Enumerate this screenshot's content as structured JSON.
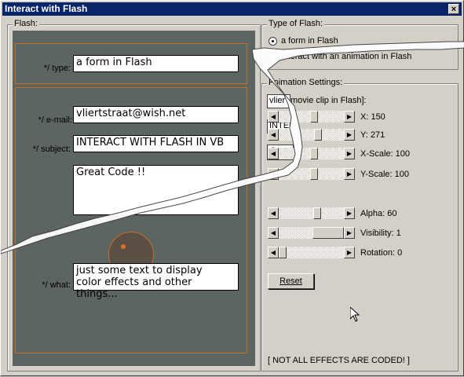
{
  "window": {
    "title": "Interact with Flash",
    "close_glyph": "×"
  },
  "flash_group": {
    "label": "Flash:",
    "type_label": "*/ type:",
    "type_value": "a form in Flash",
    "email_label": "*/ e-mail:",
    "email_value": "vliertstraat@wish.net",
    "subject_label": "*/ subject:",
    "subject_value": "INTERACT WITH FLASH IN VB",
    "code_value": "Great Code !!",
    "what_label": "*/ what:",
    "what_value_line1": "just some text to display",
    "what_value_line2": "color effects and other things..."
  },
  "type_group": {
    "label": "Type of Flash:",
    "options": [
      {
        "label": "a form in Flash",
        "selected": true
      },
      {
        "label": "interact with an animation in Flash",
        "selected": false
      }
    ]
  },
  "settings_group": {
    "label": "Foimation Settings:",
    "movie_box": "vlier",
    "movie_label": "movie clip in Flash]:",
    "inter_box": "INTER",
    "great_box": "Great C",
    "sliders": [
      {
        "label": "X: 150",
        "level": 0.55
      },
      {
        "label": "Y: 271",
        "level": 0.62
      },
      {
        "label": "X-Scale: 100",
        "level": 0.55
      },
      {
        "label": "Y-Scale: 100",
        "level": 0.55
      },
      {
        "label": "Alpha: 60",
        "level": 0.6
      },
      {
        "label": "Visibility: 1",
        "level": 1.0
      },
      {
        "label": "Rotation: 0",
        "level": 0.0
      }
    ],
    "reset_label": "Reset",
    "note": "[ NOT ALL EFFECTS ARE CODED! ]"
  },
  "colors": {
    "flash_bg": "#5d6560",
    "accent_orange": "#c86b28",
    "title_bar": "#0a246a"
  }
}
